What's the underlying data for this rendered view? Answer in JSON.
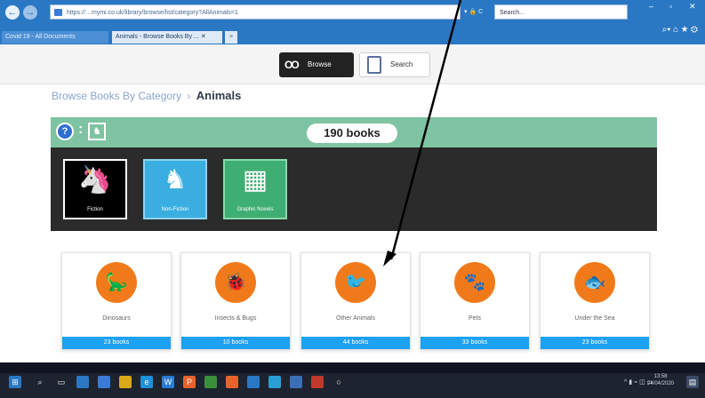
{
  "browser": {
    "address": "https://…mymi.co.uk/library/browse/list/category?AllAnimals=1",
    "search_placeholder": "Search...",
    "address_controls": "▾ 🔒 C",
    "tabs": [
      {
        "label": "Covid 19 - All Documents"
      },
      {
        "label": "Animals - Browse Books By ... ✕"
      }
    ]
  },
  "top_nav": {
    "browse_label": "Browse",
    "search_label": "Search"
  },
  "breadcrumb": {
    "parent": "Browse Books By Category",
    "separator": "›",
    "current": "Animals"
  },
  "panel": {
    "count": "190 books",
    "colon": ":"
  },
  "book_types": [
    {
      "label": "Fiction",
      "icon": "unicorn-icon"
    },
    {
      "label": "Non-Fiction",
      "icon": "horse-icon"
    },
    {
      "label": "Graphic Novels",
      "icon": "comic-icon"
    }
  ],
  "categories": [
    {
      "name": "Dinosaurs",
      "count": "23 books",
      "icon": "dinosaur-icon"
    },
    {
      "name": "Insects & Bugs",
      "count": "10 books",
      "icon": "bug-icon"
    },
    {
      "name": "Other Animals",
      "count": "44 books",
      "icon": "kiwi-bird-icon"
    },
    {
      "name": "Pets",
      "count": "33 books",
      "icon": "pet-icon"
    },
    {
      "name": "Under the Sea",
      "count": "23 books",
      "icon": "fish-icon"
    }
  ],
  "taskbar": {
    "time": "13:58",
    "date": "24/04/2020"
  },
  "colors": {
    "accent_green": "#7ec4a2",
    "orange": "#f07a1a",
    "blue": "#1da1f2",
    "dark": "#2b2b2b"
  }
}
